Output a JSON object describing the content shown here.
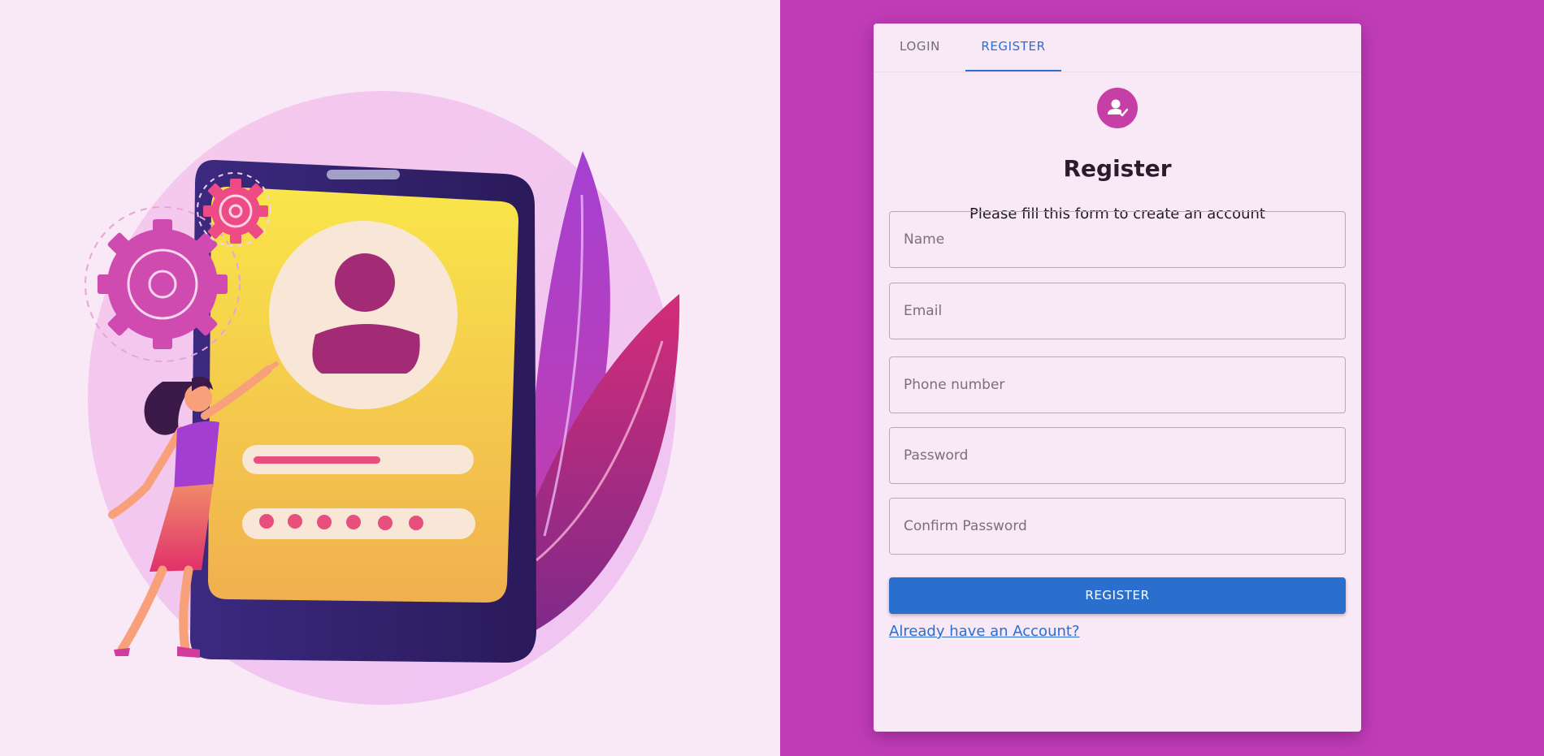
{
  "tabs": [
    {
      "label": "LOGIN",
      "active": false
    },
    {
      "label": "REGISTER",
      "active": true
    }
  ],
  "form": {
    "avatar_icon": "user-check-icon",
    "title": "Register",
    "subtitle": "Please fill this form to create an account",
    "fields": [
      {
        "placeholder": "Name",
        "value": ""
      },
      {
        "placeholder": "Email",
        "value": ""
      },
      {
        "placeholder": "Phone number",
        "value": ""
      },
      {
        "placeholder": "Password",
        "value": ""
      },
      {
        "placeholder": "Confirm Password",
        "value": ""
      }
    ],
    "submit_label": "REGISTER",
    "login_link": "Already have an Account?"
  },
  "illustration": {
    "name": "phone-login-illustration"
  },
  "colors": {
    "page_bg": "#f9e8f6",
    "right_bg": "#c03cb7",
    "accent": "#2a6fce",
    "avatar": "#c63fa6"
  }
}
